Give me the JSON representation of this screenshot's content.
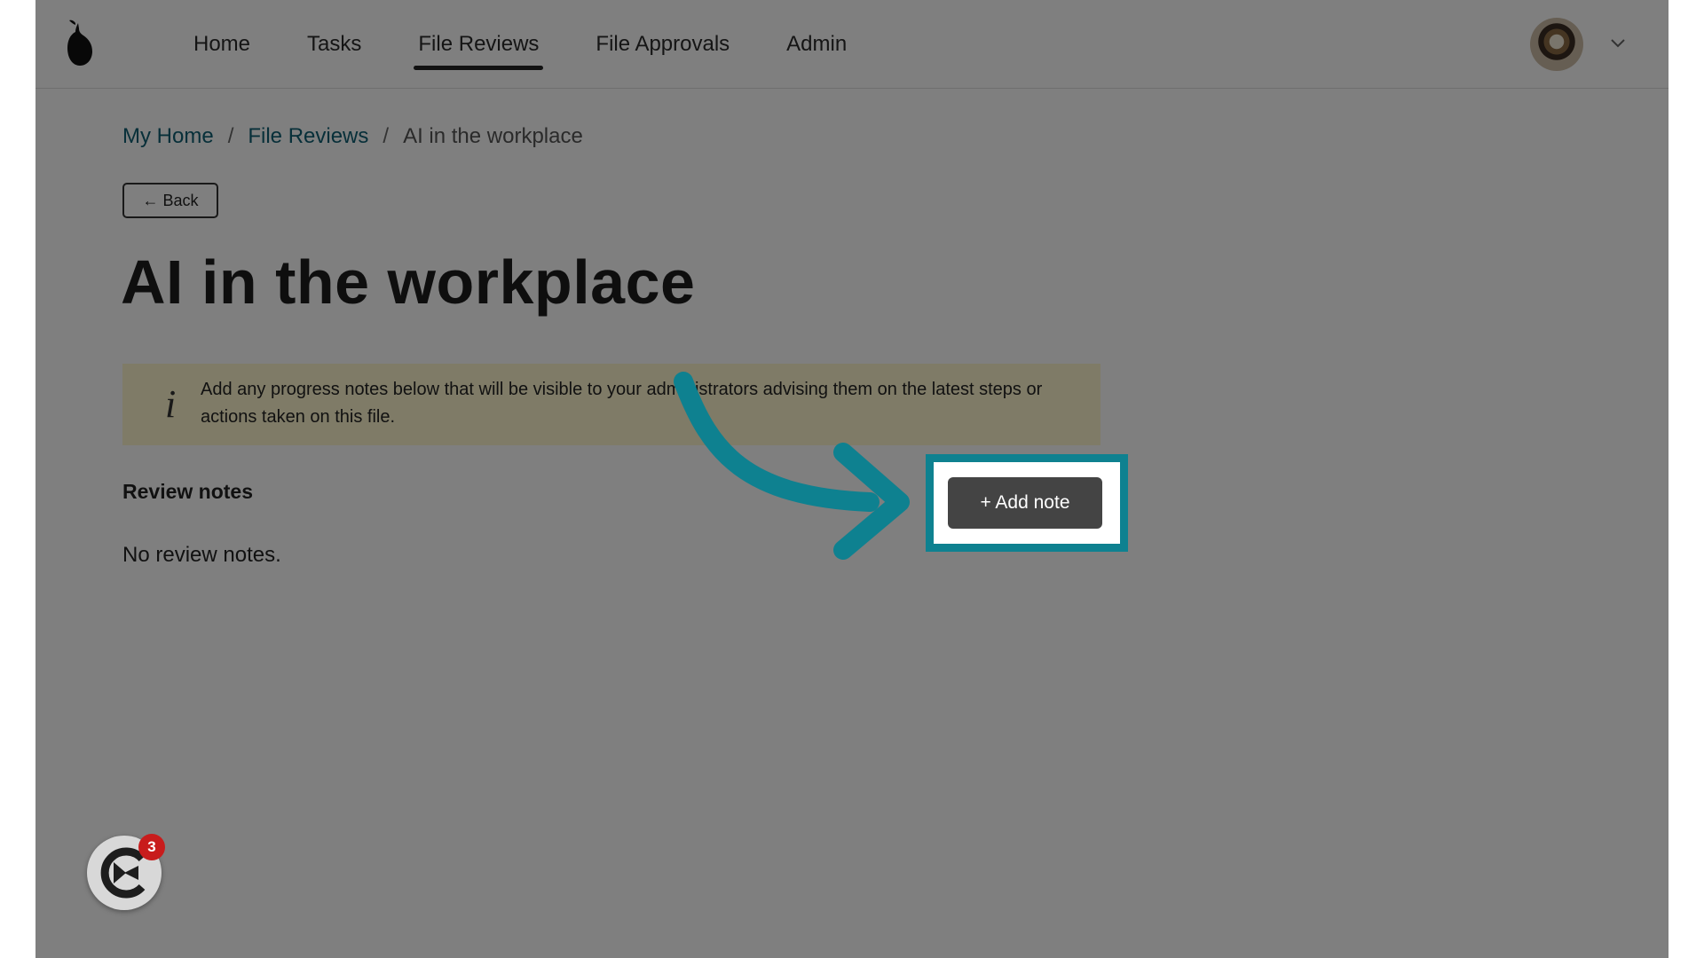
{
  "nav": {
    "items": [
      {
        "label": "Home",
        "active": false
      },
      {
        "label": "Tasks",
        "active": false
      },
      {
        "label": "File Reviews",
        "active": true
      },
      {
        "label": "File Approvals",
        "active": false
      },
      {
        "label": "Admin",
        "active": false
      }
    ]
  },
  "breadcrumb": {
    "items": [
      {
        "label": "My Home"
      },
      {
        "label": "File Reviews"
      },
      {
        "label": "AI in the workplace"
      }
    ],
    "separator": "/"
  },
  "back_label": "← Back",
  "page_title": "AI in the workplace",
  "info": {
    "icon": "info-italic-i",
    "text": "Add any progress notes below that will be visible to your administrators advising them on the latest steps or actions taken on this file."
  },
  "review_notes": {
    "title": "Review notes",
    "empty": "No review notes."
  },
  "add_note_label": "+ Add note",
  "launcher": {
    "badge_count": "3"
  },
  "colors": {
    "highlight": "#0e8190",
    "link": "#0e5f73",
    "info_bg": "#fff7cf",
    "badge": "#c81c1c"
  }
}
